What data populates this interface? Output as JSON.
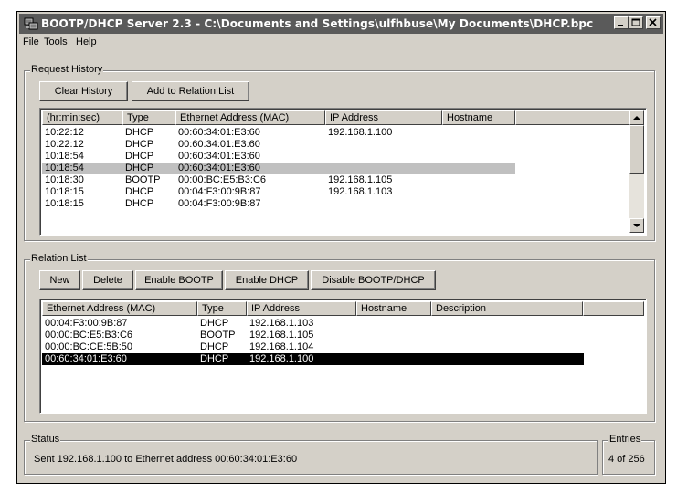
{
  "window": {
    "title": "BOOTP/DHCP Server 2.3 - C:\\Documents and Settings\\ulfhbuse\\My Documents\\DHCP.bpc",
    "icon": "network-server-icon"
  },
  "menu": [
    "File",
    "Tools",
    "Help"
  ],
  "request_history": {
    "label": "Request History",
    "buttons": {
      "clear": "Clear History",
      "add": "Add to Relation List"
    },
    "columns": [
      "(hr:min:sec)",
      "Type",
      "Ethernet Address (MAC)",
      "IP Address",
      "Hostname"
    ],
    "rows": [
      [
        "10:22:12",
        "DHCP",
        "00:60:34:01:E3:60",
        "192.168.1.100",
        ""
      ],
      [
        "10:22:12",
        "DHCP",
        "00:60:34:01:E3:60",
        "",
        ""
      ],
      [
        "10:18:54",
        "DHCP",
        "00:60:34:01:E3:60",
        "",
        ""
      ],
      [
        "10:18:54",
        "DHCP",
        "00:60:34:01:E3:60",
        "",
        ""
      ],
      [
        "10:18:30",
        "BOOTP",
        "00:00:BC:E5:B3:C6",
        "192.168.1.105",
        ""
      ],
      [
        "10:18:15",
        "DHCP",
        "00:04:F3:00:9B:87",
        "192.168.1.103",
        ""
      ],
      [
        "10:18:15",
        "DHCP",
        "00:04:F3:00:9B:87",
        "",
        ""
      ]
    ],
    "selected_row": 3
  },
  "relation_list": {
    "label": "Relation List",
    "buttons": {
      "new": "New",
      "delete": "Delete",
      "enable_bootp": "Enable BOOTP",
      "enable_dhcp": "Enable DHCP",
      "disable": "Disable BOOTP/DHCP"
    },
    "columns": [
      "Ethernet Address (MAC)",
      "Type",
      "IP Address",
      "Hostname",
      "Description"
    ],
    "rows": [
      [
        "00:04:F3:00:9B:87",
        "DHCP",
        "192.168.1.103",
        "",
        ""
      ],
      [
        "00:00:BC:E5:B3:C6",
        "BOOTP",
        "192.168.1.105",
        "",
        ""
      ],
      [
        "00:00:BC:CE:5B:50",
        "DHCP",
        "192.168.1.104",
        "",
        ""
      ],
      [
        "00:60:34:01:E3:60",
        "DHCP",
        "192.168.1.100",
        "",
        ""
      ]
    ],
    "selected_row": 3
  },
  "status": {
    "label": "Status",
    "text": "Sent 192.168.1.100 to Ethernet address 00:60:34:01:E3:60"
  },
  "entries": {
    "label": "Entries",
    "text": "4 of 256"
  }
}
